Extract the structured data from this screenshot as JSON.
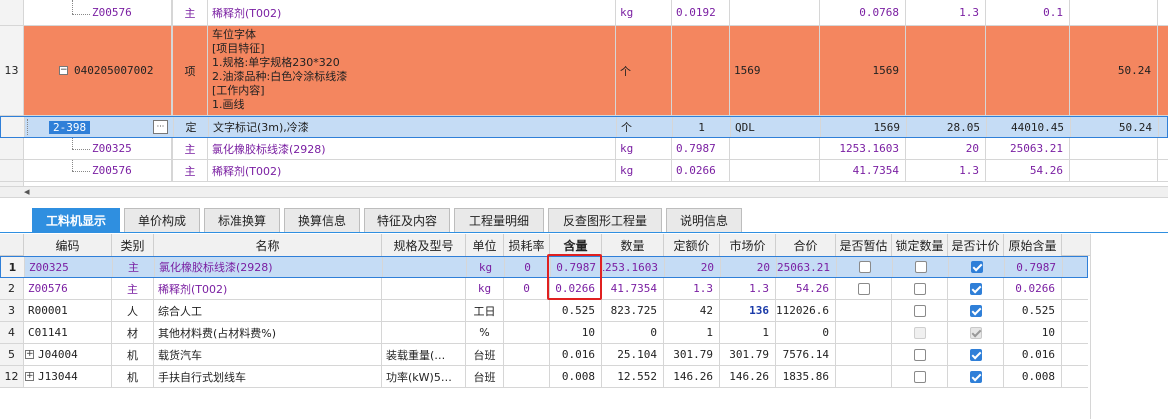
{
  "top_grid": {
    "rows": [
      {
        "num": "",
        "code": "Z00576",
        "type": "主",
        "name": "稀释剂(T002)",
        "unit": "kg",
        "qty": "0.0192",
        "v1": "",
        "v2": "0.0768",
        "v3": "1.3",
        "v4": "0.1",
        "v5": ""
      },
      {
        "num": "13",
        "code": "040205007002",
        "type": "项",
        "name_lines": [
          "车位字体",
          "[项目特征]",
          "1.规格:单字规格230*320",
          "2.油漆品种:白色冷涂标线漆",
          "[工作内容]",
          "1.画线"
        ],
        "unit": "个",
        "qty": "",
        "v1": "1569",
        "v2": "1569",
        "v3": "",
        "v4": "",
        "v5": "50.24"
      },
      {
        "num": "",
        "code": "2-398",
        "type": "定",
        "name": "文字标记(3m),冷漆",
        "unit": "个",
        "qty": "1",
        "v1": "QDL",
        "v2": "1569",
        "v3": "28.05",
        "v4": "44010.45",
        "v5": "50.24",
        "more": "···"
      },
      {
        "num": "",
        "code": "Z00325",
        "type": "主",
        "name": "氯化橡胶标线漆(2928)",
        "unit": "kg",
        "qty": "0.7987",
        "v1": "",
        "v2": "1253.1603",
        "v3": "20",
        "v4": "25063.21",
        "v5": ""
      },
      {
        "num": "",
        "code": "Z00576",
        "type": "主",
        "name": "稀释剂(T002)",
        "unit": "kg",
        "qty": "0.0266",
        "v1": "",
        "v2": "41.7354",
        "v3": "1.3",
        "v4": "54.26",
        "v5": ""
      }
    ]
  },
  "scroll_arrow": "◂",
  "tabs": [
    "工料机显示",
    "单价构成",
    "标准换算",
    "换算信息",
    "特征及内容",
    "工程量明细",
    "反查图形工程量",
    "说明信息"
  ],
  "bottom_grid": {
    "headers": [
      "编码",
      "类别",
      "名称",
      "规格及型号",
      "单位",
      "损耗率",
      "含量",
      "数量",
      "定额价",
      "市场价",
      "合价",
      "是否暂估",
      "锁定数量",
      "是否计价",
      "原始含量"
    ],
    "rows": [
      {
        "num": "1",
        "code": "Z00325",
        "type": "主",
        "name": "氯化橡胶标线漆(2928)",
        "spec": "",
        "unit": "kg",
        "loss": "0",
        "content": "0.7987",
        "qty": "1253.1603",
        "price": "20",
        "market": "20",
        "total": "25063.21",
        "est": false,
        "lock": false,
        "priced": true,
        "orig": "0.7987"
      },
      {
        "num": "2",
        "code": "Z00576",
        "type": "主",
        "name": "稀释剂(T002)",
        "spec": "",
        "unit": "kg",
        "loss": "0",
        "content": "0.0266",
        "qty": "41.7354",
        "price": "1.3",
        "market": "1.3",
        "total": "54.26",
        "est": false,
        "lock": false,
        "priced": true,
        "orig": "0.0266"
      },
      {
        "num": "3",
        "code": "R00001",
        "type": "人",
        "name": "综合人工",
        "spec": "",
        "unit": "工日",
        "loss": "",
        "content": "0.525",
        "qty": "823.725",
        "price": "42",
        "market": "136",
        "total": "112026.6",
        "lock": false,
        "priced": true,
        "orig": "0.525"
      },
      {
        "num": "4",
        "code": "C01141",
        "type": "材",
        "name": "其他材料费(占材料费%)",
        "spec": "",
        "unit": "%",
        "loss": "",
        "content": "10",
        "qty": "0",
        "price": "1",
        "market": "1",
        "total": "0",
        "lock": false,
        "priced": true,
        "orig": "10"
      },
      {
        "num": "5",
        "code": "J04004",
        "type": "机",
        "name": "载货汽车",
        "spec": "装载重量(…",
        "unit": "台班",
        "loss": "",
        "content": "0.016",
        "qty": "25.104",
        "price": "301.79",
        "market": "301.79",
        "total": "7576.14",
        "lock": false,
        "priced": true,
        "orig": "0.016"
      },
      {
        "num": "12",
        "code": "J13044",
        "type": "机",
        "name": "手扶自行式划线车",
        "spec": "功率(kW)5…",
        "unit": "台班",
        "loss": "",
        "content": "0.008",
        "qty": "12.552",
        "price": "146.26",
        "market": "146.26",
        "total": "1835.86",
        "lock": false,
        "priced": true,
        "orig": "0.008"
      }
    ]
  },
  "colors": {
    "orange_row": "#f4865f",
    "selected_row": "#c5dcf5",
    "highlight_box": "#e02020",
    "purple_text": "#7a1fa2",
    "tab_active": "#2f8fe0"
  }
}
